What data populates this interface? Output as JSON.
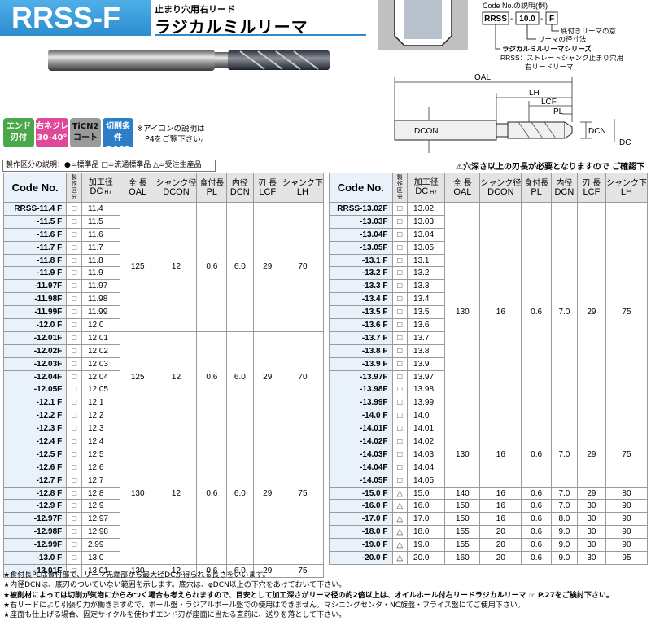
{
  "header": {
    "code": "RRSS-F",
    "subtitle": "止まり穴用右リード",
    "name": "ラジカルミルリーマ"
  },
  "badges": [
    {
      "line1": "エンド",
      "line2": "刃付",
      "color": "#4aa84a"
    },
    {
      "line1": "右ネジレ",
      "line2": "30-40°",
      "color": "#e0489a"
    },
    {
      "line1": "TiCN2",
      "line2": "コート",
      "color": "#9a9a9a"
    },
    {
      "line1": "切削条件",
      "line2": "P.133",
      "color": "#2d7ec9"
    }
  ],
  "badge_note": {
    "line1": "※アイコンの説明は",
    "line2": "P4をご覧下さい。"
  },
  "code_example": {
    "caption": "Code No.の説明(例)",
    "p1": "RRSS",
    "p2": "10.0",
    "p3": "F",
    "d3": "底付きリーマの意",
    "d2": "リーマの径寸法",
    "d1": "ラジカルミルリーマシリーズ",
    "d1b": "RRSS：ストレートシャンク止まり穴用",
    "d1c": "右リードリーマ"
  },
  "dims": {
    "oal": "OAL",
    "lh": "LH",
    "lcf": "LCF",
    "pl": "PL",
    "dcon": "DCON",
    "dcn": "DCN",
    "dc": "DC"
  },
  "legend": "製作区分の説明：●=標準品 □=流通標準品 △=受注生産品",
  "warning": "⚠穴深さ以上の刃長が必要となりますので ご確認下さい。",
  "columns": {
    "code": "Code No.",
    "kubun": "製作区分",
    "dc": "加工径",
    "dc_sub": "DC",
    "dc_tol": "H7",
    "oal": "全 長",
    "oal_sub": "OAL",
    "dcon": "シャンク径",
    "dcon_sub": "DCON",
    "pl": "食付長",
    "pl_sub": "PL",
    "dcn": "内径",
    "dcn_sub": "DCN",
    "lcf": "刃 長",
    "lcf_sub": "LCF",
    "lh": "シャンク下",
    "lh_sub": "LH"
  },
  "left_table": {
    "groups": [
      {
        "oal": "125",
        "dcon": "12",
        "pl": "0.6",
        "dcn": "6.0",
        "lcf": "29",
        "lh": "70",
        "rows": [
          [
            "RRSS-11.4  F",
            "□",
            "11.4"
          ],
          [
            "-11.5  F",
            "□",
            "11.5"
          ],
          [
            "-11.6  F",
            "□",
            "11.6"
          ],
          [
            "-11.7  F",
            "□",
            "11.7"
          ],
          [
            "-11.8  F",
            "□",
            "11.8"
          ],
          [
            "-11.9  F",
            "□",
            "11.9"
          ],
          [
            "-11.97F",
            "□",
            "11.97"
          ],
          [
            "-11.98F",
            "□",
            "11.98"
          ],
          [
            "-11.99F",
            "□",
            "11.99"
          ],
          [
            "-12.0  F",
            "□",
            "12.0"
          ]
        ]
      },
      {
        "oal": "125",
        "dcon": "12",
        "pl": "0.6",
        "dcn": "6.0",
        "lcf": "29",
        "lh": "70",
        "rows": [
          [
            "-12.01F",
            "□",
            "12.01"
          ],
          [
            "-12.02F",
            "□",
            "12.02"
          ],
          [
            "-12.03F",
            "□",
            "12.03"
          ],
          [
            "-12.04F",
            "□",
            "12.04"
          ],
          [
            "-12.05F",
            "□",
            "12.05"
          ],
          [
            "-12.1  F",
            "□",
            "12.1"
          ],
          [
            "-12.2  F",
            "□",
            "12.2"
          ]
        ]
      },
      {
        "oal": "130",
        "dcon": "12",
        "pl": "0.6",
        "dcn": "6.0",
        "lcf": "29",
        "lh": "75",
        "rows": [
          [
            "-12.3  F",
            "□",
            "12.3"
          ],
          [
            "-12.4  F",
            "□",
            "12.4"
          ],
          [
            "-12.5  F",
            "□",
            "12.5"
          ],
          [
            "-12.6  F",
            "□",
            "12.6"
          ],
          [
            "-12.7  F",
            "□",
            "12.7"
          ],
          [
            "-12.8  F",
            "□",
            "12.8"
          ],
          [
            "-12.9  F",
            "□",
            "12.9"
          ],
          [
            "-12.97F",
            "□",
            "12.97"
          ],
          [
            "-12.98F",
            "□",
            "12.98"
          ],
          [
            "-12.99F",
            "□",
            "2.99"
          ],
          [
            "-13.0  F",
            "□",
            "13.0"
          ]
        ]
      },
      {
        "oal": "130",
        "dcon": "12",
        "pl": "0.6",
        "dcn": "6.0",
        "lcf": "29",
        "lh": "75",
        "rows": [
          [
            "-13.01F",
            "□",
            "13.01"
          ]
        ]
      }
    ]
  },
  "right_table": {
    "groups": [
      {
        "oal": "130",
        "dcon": "16",
        "pl": "0.6",
        "dcn": "7.0",
        "lcf": "29",
        "lh": "75",
        "rows": [
          [
            "RRSS-13.02F",
            "□",
            "13.02"
          ],
          [
            "-13.03F",
            "□",
            "13.03"
          ],
          [
            "-13.04F",
            "□",
            "13.04"
          ],
          [
            "-13.05F",
            "□",
            "13.05"
          ],
          [
            "-13.1  F",
            "□",
            "13.1"
          ],
          [
            "-13.2  F",
            "□",
            "13.2"
          ],
          [
            "-13.3  F",
            "□",
            "13.3"
          ],
          [
            "-13.4  F",
            "□",
            "13.4"
          ],
          [
            "-13.5  F",
            "□",
            "13.5"
          ],
          [
            "-13.6  F",
            "□",
            "13.6"
          ],
          [
            "-13.7  F",
            "□",
            "13.7"
          ],
          [
            "-13.8  F",
            "□",
            "13.8"
          ],
          [
            "-13.9  F",
            "□",
            "13.9"
          ],
          [
            "-13.97F",
            "□",
            "13.97"
          ],
          [
            "-13.98F",
            "□",
            "13.98"
          ],
          [
            "-13.99F",
            "□",
            "13.99"
          ],
          [
            "-14.0  F",
            "□",
            "14.0"
          ]
        ]
      },
      {
        "oal": "130",
        "dcon": "16",
        "pl": "0.6",
        "dcn": "7.0",
        "lcf": "29",
        "lh": "75",
        "rows": [
          [
            "-14.01F",
            "□",
            "14.01"
          ],
          [
            "-14.02F",
            "□",
            "14.02"
          ],
          [
            "-14.03F",
            "□",
            "14.03"
          ],
          [
            "-14.04F",
            "□",
            "14.04"
          ],
          [
            "-14.05F",
            "□",
            "14.05"
          ]
        ]
      },
      {
        "oal": "140",
        "dcon": "16",
        "pl": "0.6",
        "dcn": "7.0",
        "lcf": "29",
        "lh": "80",
        "rows": [
          [
            "-15.0  F",
            "△",
            "15.0"
          ]
        ]
      },
      {
        "oal": "150",
        "dcon": "16",
        "pl": "0.6",
        "dcn": "7.0",
        "lcf": "30",
        "lh": "90",
        "rows": [
          [
            "-16.0  F",
            "△",
            "16.0"
          ]
        ]
      },
      {
        "oal": "150",
        "dcon": "16",
        "pl": "0.6",
        "dcn": "8.0",
        "lcf": "30",
        "lh": "90",
        "rows": [
          [
            "-17.0  F",
            "△",
            "17.0"
          ]
        ]
      },
      {
        "oal": "155",
        "dcon": "20",
        "pl": "0.6",
        "dcn": "9.0",
        "lcf": "30",
        "lh": "90",
        "rows": [
          [
            "-18.0  F",
            "△",
            "18.0"
          ]
        ]
      },
      {
        "oal": "155",
        "dcon": "20",
        "pl": "0.6",
        "dcn": "9.0",
        "lcf": "30",
        "lh": "90",
        "rows": [
          [
            "-19.0  F",
            "△",
            "19.0"
          ]
        ]
      },
      {
        "oal": "160",
        "dcon": "20",
        "pl": "0.6",
        "dcn": "9.0",
        "lcf": "30",
        "lh": "95",
        "rows": [
          [
            "-20.0  F",
            "△",
            "20.0"
          ]
        ]
      }
    ]
  },
  "footnotes": [
    "★食付長PLは食付部で、リーマ先端部から最大径DCが得られる長さをいいます。",
    "★内径DCNは、底刃のついていない範囲を示します。底穴は、φDCN以上の下穴をあけておいて下さい。",
    "★被削材によっては切削が気泡にからみつく場合も考えられますので、目安として加工深さがリーマ径の約2倍以上は、オイルホール付右リードラジカルリーマ ☞ P.27をご検討下さい。",
    "★右リードにより引張り力が働きますので、ボール盤・ラジアルボール盤での使用はできません。マシニングセンタ・NC旋盤・フライス盤にてご使用下さい。",
    "★座面も仕上げる場合、固定サイクルを使わずエンド刃が座面に当たる直前に、送りを落として下さい。"
  ]
}
